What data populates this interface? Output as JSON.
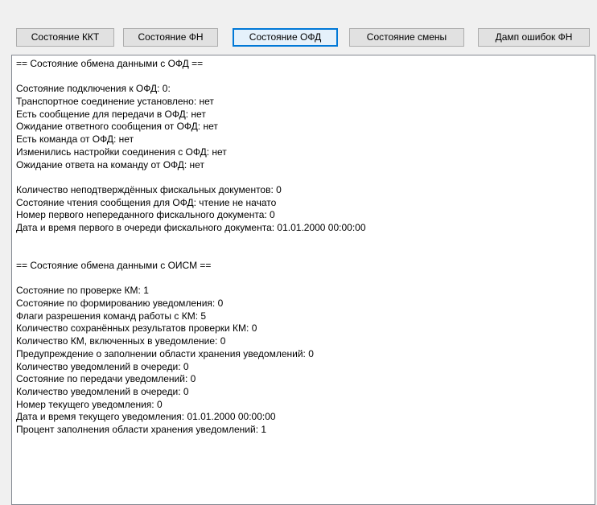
{
  "toolbar": {
    "buttons": [
      {
        "label": "Состояние ККТ"
      },
      {
        "label": "Состояние ФН"
      },
      {
        "label": "Состояние ОФД",
        "active": true
      },
      {
        "label": "Состояние смены"
      },
      {
        "label": "Дамп ошибок ФН"
      }
    ]
  },
  "output": {
    "lines": [
      "== Состояние обмена данными с ОФД ==",
      "",
      "Состояние подключения к ОФД: 0:",
      "Транспортное соединение установлено: нет",
      "Есть сообщение для передачи в ОФД: нет",
      "Ожидание ответного сообщения от ОФД: нет",
      "Есть команда от ОФД: нет",
      "Изменились настройки соединения с ОФД: нет",
      "Ожидание ответа на команду от ОФД: нет",
      "",
      "Количество неподтверждённых фискальных документов: 0",
      "Состояние чтения сообщения для ОФД: чтение не начато",
      "Номер первого непереданного фискального документа: 0",
      "Дата и время первого в очереди фискального документа: 01.01.2000 00:00:00",
      "",
      "",
      "== Состояние обмена данными с ОИСМ ==",
      "",
      "Состояние по проверке КМ: 1",
      "Состояние по формированию уведомления: 0",
      "Флаги разрешения команд работы с КМ: 5",
      "Количество сохранённых результатов проверки КМ: 0",
      "Количество КМ, включенных в уведомление: 0",
      "Предупреждение о заполнении области хранения уведомлений: 0",
      "Количество уведомлений в очереди: 0",
      "Состояние по передачи уведомлений: 0",
      "Количество уведомлений в очереди: 0",
      "Номер текущего уведомления: 0",
      "Дата и время текущего уведомления: 01.01.2000 00:00:00",
      "Процент заполнения области хранения уведомлений: 1"
    ]
  }
}
